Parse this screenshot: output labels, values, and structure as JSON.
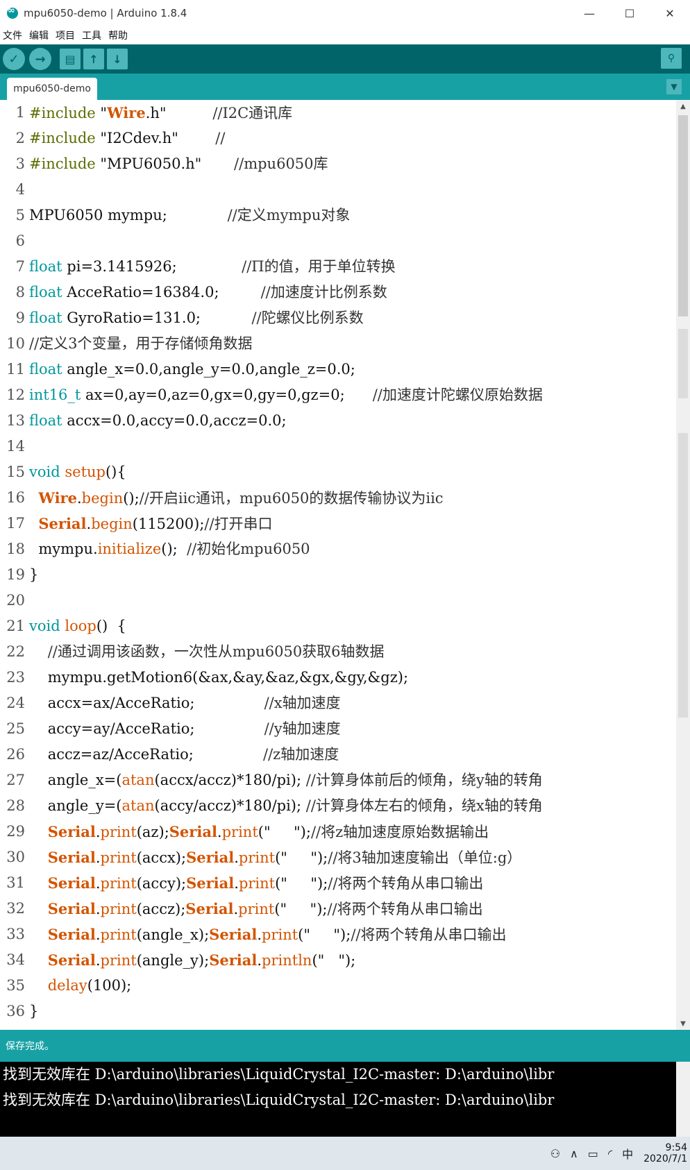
{
  "window": {
    "title": "mpu6050-demo | Arduino 1.8.4",
    "minimize": "—",
    "maximize": "☐",
    "close": "✕"
  },
  "menu": [
    "文件",
    "编辑",
    "项目",
    "工具",
    "帮助"
  ],
  "toolbar": {
    "verify": "✓",
    "upload": "→",
    "new": "▤",
    "open": "↑",
    "save": "↓",
    "serial_monitor": "⚲"
  },
  "tabs": [
    {
      "label": "mpu6050-demo"
    }
  ],
  "tab_menu": "▼",
  "editor": {
    "line_numbers": [
      "1",
      "2",
      "3",
      "4",
      "5",
      "6",
      "7",
      "8",
      "9",
      "10",
      "11",
      "12",
      "13",
      "14",
      "15",
      "16",
      "17",
      "18",
      "19",
      "20",
      "21",
      "22",
      "23",
      "24",
      "25",
      "26",
      "27",
      "28",
      "29",
      "30",
      "31",
      "32",
      "33",
      "34",
      "35",
      "36"
    ],
    "lines": [
      "#include \"Wire.h\"          //I2C通讯库",
      "#include \"I2Cdev.h\"        //",
      "#include \"MPU6050.h\"       //mpu6050库",
      "",
      "MPU6050 mympu;             //定义mympu对象",
      "",
      "float pi=3.1415926;              //Π的值，用于单位转换",
      "float AcceRatio=16384.0;         //加速度计比例系数",
      "float GyroRatio=131.0;           //陀螺仪比例系数",
      "//定义3个变量，用于存储倾角数据",
      "float angle_x=0.0,angle_y=0.0,angle_z=0.0;",
      "int16_t ax=0,ay=0,az=0,gx=0,gy=0,gz=0;      //加速度计陀螺仪原始数据",
      "float accx=0.0,accy=0.0,accz=0.0;",
      "",
      "void setup(){",
      "  Wire.begin();//开启iic通讯，mpu6050的数据传输协议为iic",
      "  Serial.begin(115200);//打开串口",
      "  mympu.initialize();  //初始化mpu6050",
      "}",
      "",
      "void loop()  {",
      "    //通过调用该函数，一次性从mpu6050获取6轴数据",
      "    mympu.getMotion6(&ax,&ay,&az,&gx,&gy,&gz);",
      "    accx=ax/AcceRatio;               //x轴加速度",
      "    accy=ay/AcceRatio;               //y轴加速度",
      "    accz=az/AcceRatio;               //z轴加速度",
      "    angle_x=(atan(accx/accz)*180/pi); //计算身体前后的倾角，绕y轴的转角",
      "    angle_y=(atan(accy/accz)*180/pi); //计算身体左右的倾角，绕x轴的转角",
      "    Serial.print(az);Serial.print(\"     \");//将z轴加速度原始数据输出",
      "    Serial.print(accx);Serial.print(\"     \");//将3轴加速度输出（单位:g）",
      "    Serial.print(accy);Serial.print(\"     \");//将两个转角从串口输出",
      "    Serial.print(accz);Serial.print(\"     \");//将两个转角从串口输出",
      "    Serial.print(angle_x);Serial.print(\"     \");//将两个转角从串口输出",
      "    Serial.print(angle_y);Serial.println(\"   \");",
      "    delay(100);",
      "}"
    ]
  },
  "status": "保存完成。",
  "console": [
    "找到无效库在 D:\\arduino\\libraries\\LiquidCrystal_I2C-master: D:\\arduino\\libr",
    "找到无效库在 D:\\arduino\\libraries\\LiquidCrystal_I2C-master: D:\\arduino\\libr"
  ],
  "taskbar": {
    "ime": "中",
    "time": "9:54",
    "date": "2020/7/1"
  }
}
